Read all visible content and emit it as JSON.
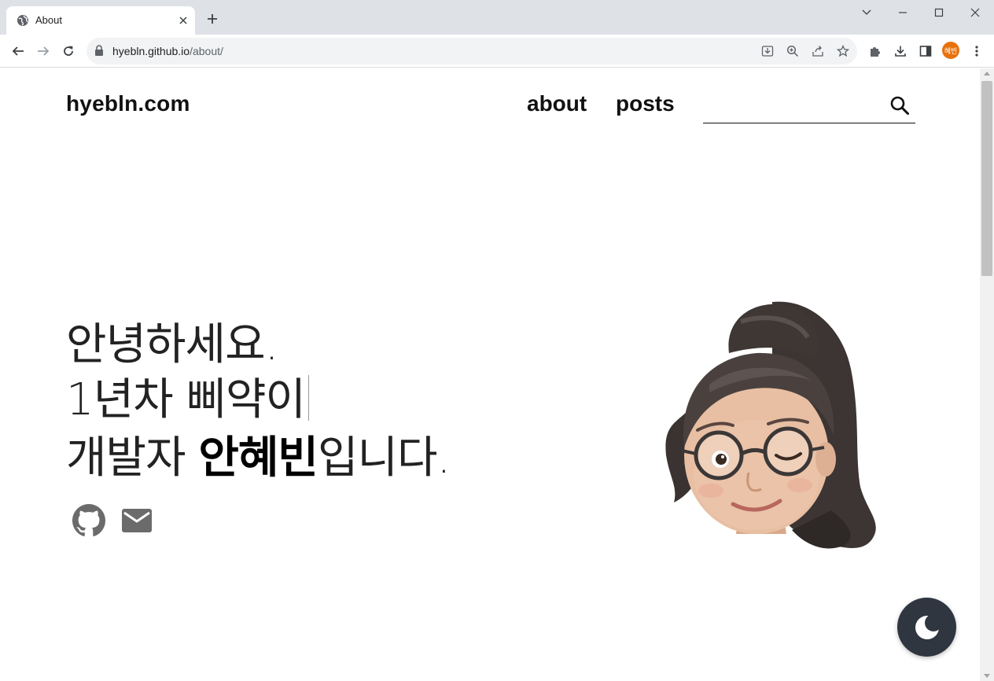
{
  "browser": {
    "tab_title": "About",
    "url_host": "hyebln.github.io",
    "url_path": "/about/",
    "profile_label": "혜빈"
  },
  "site": {
    "logo": "hyebln.com",
    "nav": [
      {
        "label": "about"
      },
      {
        "label": "posts"
      }
    ],
    "search_placeholder": ""
  },
  "hero": {
    "line1": "안녕하세요.",
    "line2": "1년차 삐약이",
    "line3_prefix": "개발자 ",
    "line3_name": "안혜빈",
    "line3_suffix": "입니다."
  },
  "icons": {
    "github": "github-icon",
    "email": "mail-icon",
    "theme": "moon-icon"
  },
  "colors": {
    "toggle_bg": "#2f3640",
    "profile_bg": "#e8710a",
    "social_icon": "#6b6b6b"
  }
}
